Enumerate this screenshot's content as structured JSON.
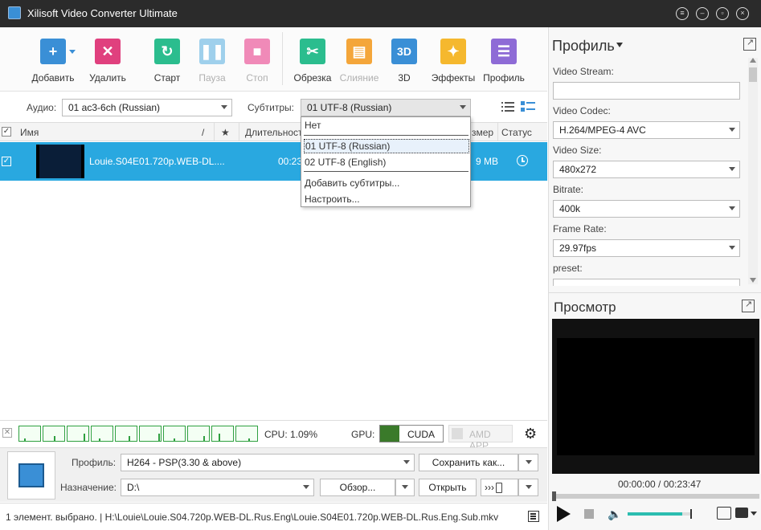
{
  "window": {
    "title": "Xilisoft Video Converter Ultimate"
  },
  "toolbar": {
    "add": "Добавить",
    "delete": "Удалить",
    "start": "Старт",
    "pause": "Пауза",
    "stop": "Стоп",
    "trim": "Обрезка",
    "merge": "Слияние",
    "three_d": "3D",
    "effects": "Эффекты",
    "profile": "Профиль",
    "three_d_icon_text": "3D"
  },
  "media": {
    "audio_label": "Аудио:",
    "audio_value": "01 ac3-6ch (Russian)",
    "subs_label": "Субтитры:",
    "subs_value": "01 UTF-8 (Russian)"
  },
  "columns": {
    "name": "Имя",
    "slash": "/",
    "star": "★",
    "duration": "Длительност",
    "size": "змер",
    "status": "Статус"
  },
  "file": {
    "name": "Louie.S04E01.720p.WEB-DL....",
    "duration": "00:23",
    "size": "9 MB"
  },
  "subs_dropdown": {
    "items": [
      "Нет",
      "01 UTF-8 (Russian)",
      "02 UTF-8 (English)",
      "Добавить субтитры...",
      "Настроить..."
    ]
  },
  "cpu": {
    "cpu_label": "CPU: 1.09%",
    "gpu_label": "GPU:",
    "cuda": "CUDA",
    "amd": "AMD APP"
  },
  "output": {
    "profile_label": "Профиль:",
    "profile_value": "H264 - PSP(3.30 & above)",
    "save_as": "Сохранить как...",
    "dest_label": "Назначение:",
    "dest_value": "D:\\",
    "browse": "Обзор...",
    "open": "Открыть",
    "chevrons": "›››"
  },
  "status": {
    "text": "1 элемент. выбрано. | H:\\Louie\\Louie.S04.720p.WEB-DL.Rus.Eng\\Louie.S04E01.720p.WEB-DL.Rus.Eng.Sub.mkv"
  },
  "profile_panel": {
    "title": "Профиль",
    "video_stream_label": "Video Stream:",
    "video_stream_value": "",
    "codec_label": "Video Codec:",
    "codec_value": "H.264/MPEG-4 AVC",
    "size_label": "Video Size:",
    "size_value": "480x272",
    "bitrate_label": "Bitrate:",
    "bitrate_value": "400k",
    "framerate_label": "Frame Rate:",
    "framerate_value": "29.97fps",
    "preset_label": "preset:"
  },
  "preview": {
    "title": "Просмотр",
    "time": "00:00:00 / 00:23:47",
    "volume": 0.85,
    "position": 0.0
  },
  "colors": {
    "accent": "#29a8e0",
    "titlebar": "#2b2b2b"
  }
}
